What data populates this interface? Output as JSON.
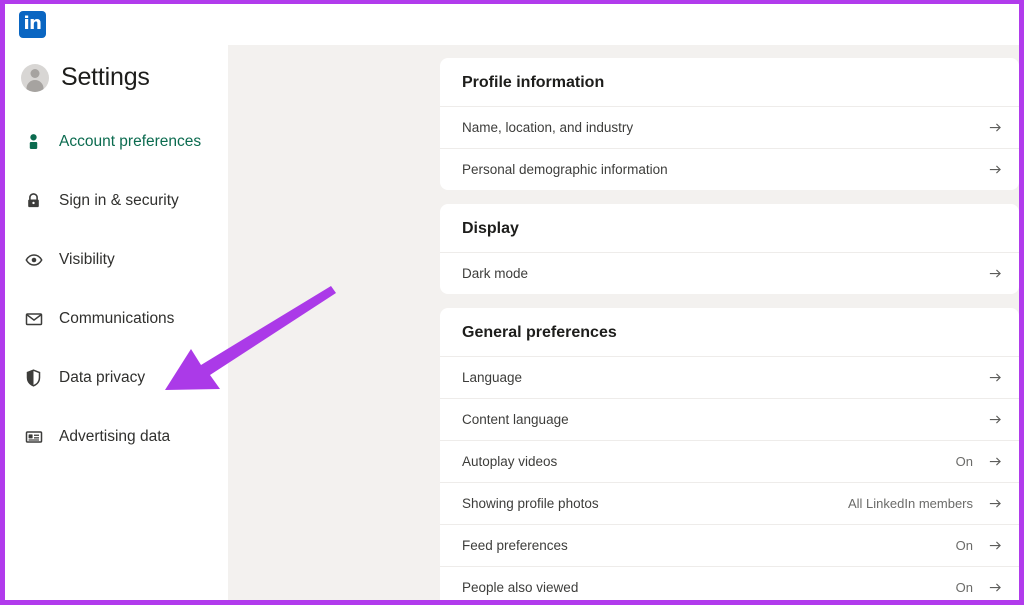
{
  "accent": {
    "annotation_purple": "#b13bec",
    "active_green": "#0b6b4f",
    "linkedin_blue": "#0a66c2",
    "page_background": "#f3f1ef"
  },
  "topbar": {
    "logo_text": "in",
    "logo_name": "linkedin-logo"
  },
  "sidebar": {
    "title": "Settings",
    "items": [
      {
        "label": "Account preferences",
        "icon": "person-icon",
        "active": true
      },
      {
        "label": "Sign in & security",
        "icon": "lock-icon",
        "active": false
      },
      {
        "label": "Visibility",
        "icon": "eye-icon",
        "active": false
      },
      {
        "label": "Communications",
        "icon": "envelope-icon",
        "active": false
      },
      {
        "label": "Data privacy",
        "icon": "shield-icon",
        "active": false
      },
      {
        "label": "Advertising data",
        "icon": "id-card-icon",
        "active": false
      }
    ]
  },
  "main": {
    "cards": [
      {
        "title": "Profile information",
        "rows": [
          {
            "label": "Name, location, and industry",
            "value": ""
          },
          {
            "label": "Personal demographic information",
            "value": ""
          }
        ]
      },
      {
        "title": "Display",
        "rows": [
          {
            "label": "Dark mode",
            "value": ""
          }
        ]
      },
      {
        "title": "General preferences",
        "rows": [
          {
            "label": "Language",
            "value": ""
          },
          {
            "label": "Content language",
            "value": ""
          },
          {
            "label": "Autoplay videos",
            "value": "On"
          },
          {
            "label": "Showing profile photos",
            "value": "All LinkedIn members"
          },
          {
            "label": "Feed preferences",
            "value": "On"
          },
          {
            "label": "People also viewed",
            "value": "On"
          }
        ]
      }
    ]
  },
  "annotation": {
    "type": "arrow",
    "points_to": "Data privacy",
    "color": "#b13bec"
  }
}
